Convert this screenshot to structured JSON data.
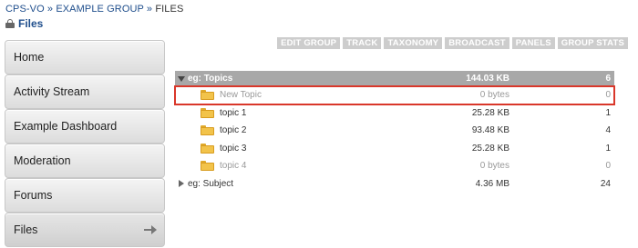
{
  "breadcrumb": {
    "root": "CPS-VO",
    "sep1": " » ",
    "group": "EXAMPLE GROUP",
    "sep2": " » ",
    "current": "FILES"
  },
  "page": {
    "title": "Files"
  },
  "sidebar": {
    "items": [
      {
        "label": "Home"
      },
      {
        "label": "Activity Stream"
      },
      {
        "label": "Example Dashboard"
      },
      {
        "label": "Moderation"
      },
      {
        "label": "Forums"
      },
      {
        "label": "Files",
        "active": true
      }
    ]
  },
  "toolbar": {
    "buttons": [
      "EDIT GROUP",
      "TRACK",
      "TAXONOMY",
      "BROADCAST",
      "PANELS",
      "GROUP STATS"
    ]
  },
  "files": {
    "group1": {
      "name": "eg: Topics",
      "size": "144.03 KB",
      "count": "6"
    },
    "rows": [
      {
        "name": "New Topic",
        "size": "0 bytes",
        "count": "0"
      },
      {
        "name": "topic 1",
        "size": "25.28 KB",
        "count": "1"
      },
      {
        "name": "topic 2",
        "size": "93.48 KB",
        "count": "4"
      },
      {
        "name": "topic 3",
        "size": "25.28 KB",
        "count": "1"
      },
      {
        "name": "topic 4",
        "size": "0 bytes",
        "count": "0"
      }
    ],
    "group2": {
      "name": "eg: Subject",
      "size": "4.36 MB",
      "count": "24"
    }
  },
  "colors": {
    "link": "#1f4e8c",
    "highlight": "#d9372a",
    "folder": "#f2c34a",
    "group_header": "#a8a8a8"
  }
}
